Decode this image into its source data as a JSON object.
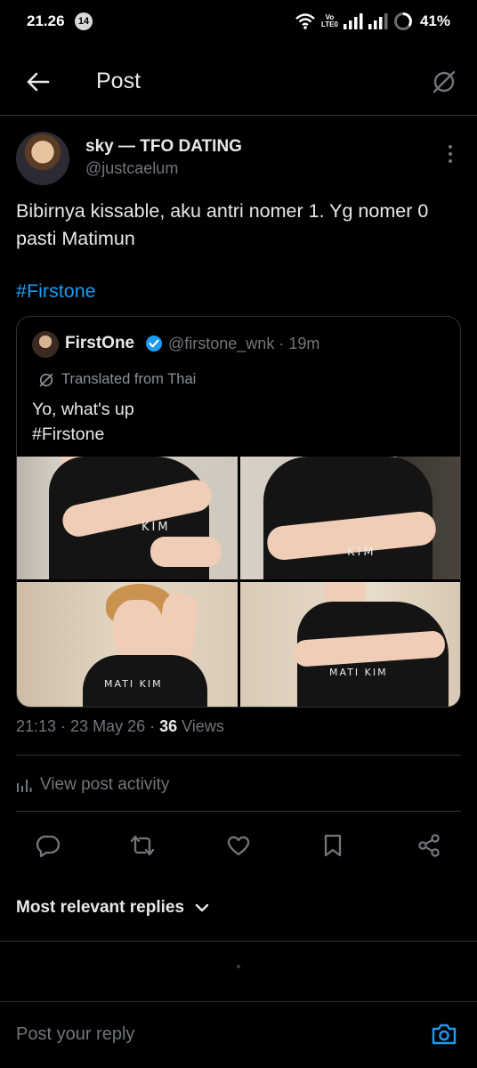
{
  "status_bar": {
    "time": "21.26",
    "notification_count": "14",
    "volte_line1": "Vo",
    "volte_line2": "LTE0",
    "battery": "41%",
    "battery_level": 0.41
  },
  "header": {
    "title": "Post",
    "back_icon": "arrow-left-icon",
    "translate_icon": "translate-icon"
  },
  "post": {
    "author_name": "sky — TFO DATING",
    "author_handle": "@justcaelum",
    "text": "Bibirnya kissable, aku antri nomer 1. Yg nomer 0 pasti Matimun",
    "hashtag": "#Firstone",
    "timestamp": "21:13 · 23 May 26 · ",
    "views_count": "36",
    "views_label": " Views"
  },
  "quote": {
    "author_name": "FirstOne",
    "verified": true,
    "meta": "@firstone_wnk · 19m",
    "translated_label": "Translated from Thai",
    "text_line1": "Yo, what's up",
    "text_line2": "#Firstone",
    "shirt_print_1": "KIM",
    "shirt_print_2": "KIM",
    "shirt_print_3": "MATI KIM",
    "shirt_print_4": "MATI KIM"
  },
  "activity": {
    "label": "View post activity",
    "icon": "bar-chart-icon"
  },
  "actions": [
    "reply-icon",
    "repost-icon",
    "like-icon",
    "bookmark-icon",
    "share-icon"
  ],
  "replies": {
    "sort_label": "Most relevant replies"
  },
  "reply_bar": {
    "placeholder": "Post your reply",
    "camera_icon": "camera-icon"
  },
  "colors": {
    "background": "#000000",
    "text": "#e7e9ea",
    "secondary": "#71767b",
    "accent": "#1d9bf0",
    "divider": "#2f3336"
  }
}
